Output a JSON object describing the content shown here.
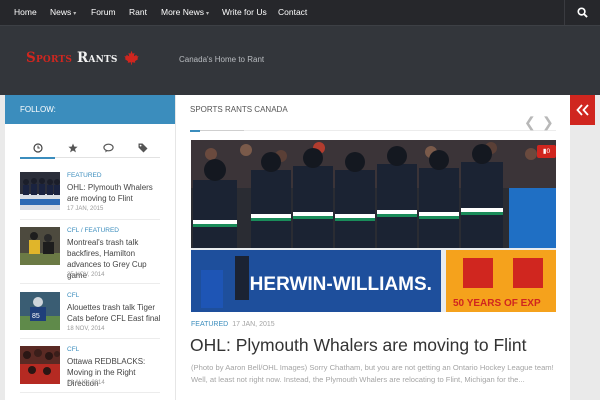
{
  "nav": {
    "items": [
      {
        "label": "Home",
        "caret": ""
      },
      {
        "label": "News",
        "caret": "▾"
      },
      {
        "label": "Forum",
        "caret": ""
      },
      {
        "label": "Rant",
        "caret": ""
      },
      {
        "label": "More News",
        "caret": "▾"
      },
      {
        "label": "Write for Us",
        "caret": ""
      },
      {
        "label": "Contact",
        "caret": ""
      }
    ],
    "search_icon": "search-icon"
  },
  "header": {
    "logo_word1": "Sports",
    "logo_word2": "Rants",
    "logo_icon": "maple-leaf-icon",
    "tagline": "Canada's Home to Rant"
  },
  "sidebar": {
    "follow_label": "FOLLOW:",
    "tabs": [
      "recent-clock-icon",
      "star-icon",
      "comments-icon",
      "tags-icon"
    ],
    "posts": [
      {
        "category": "FEATURED",
        "title": "OHL: Plymouth Whalers are moving to Flint",
        "date": "17 JAN, 2015"
      },
      {
        "category": "CFL / FEATURED",
        "title": "Montreal's trash talk backfires, Hamilton advances to Grey Cup game",
        "date": "25 NOV, 2014"
      },
      {
        "category": "CFL",
        "title": "Alouettes trash talk Tiger Cats before CFL East final",
        "date": "18 NOV, 2014"
      },
      {
        "category": "CFL",
        "title": "Ottawa REDBLACKS: Moving in the Right Direction",
        "date": "28 AUG, 2014"
      }
    ]
  },
  "main": {
    "section_title": "SPORTS RANTS CANADA",
    "featured": {
      "comment_count": "0",
      "category": "FEATURED",
      "date": "17 JAN, 2015",
      "title": "OHL: Plymouth Whalers are moving to Flint",
      "excerpt": "(Photo by Aaron Bell/OHL Images) Sorry Chatham, but you are not getting an Ontario Hockey League team! Well, at least not right now. Instead, the Plymouth Whalers are relocating to Flint, Michigan for the..."
    },
    "ad_text": "SHERWIN-WILLIAMS.",
    "ad_text2": "50 YEARS OF EXP"
  },
  "colors": {
    "accent": "#3b8dbd",
    "brand_red": "#d0261f",
    "nav_bg": "#26272b",
    "header_bg": "#33363b"
  }
}
